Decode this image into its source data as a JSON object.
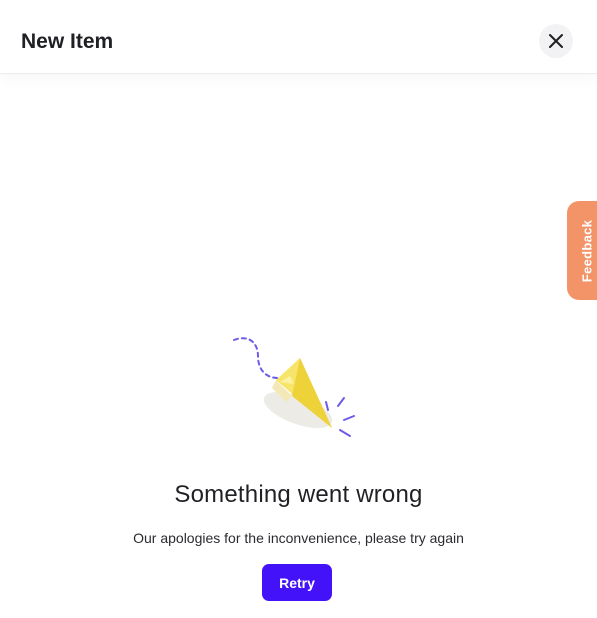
{
  "dialog": {
    "title": "New Item",
    "close_icon": "close-icon"
  },
  "feedback": {
    "label": "Feedback",
    "color": "#f39468"
  },
  "error": {
    "illustration_icon": "paper-plane-icon",
    "title": "Something went wrong",
    "message": "Our apologies for the inconvenience, please try again",
    "retry_label": "Retry"
  },
  "colors": {
    "accent": "#4412f9",
    "text": "#1f2024"
  }
}
